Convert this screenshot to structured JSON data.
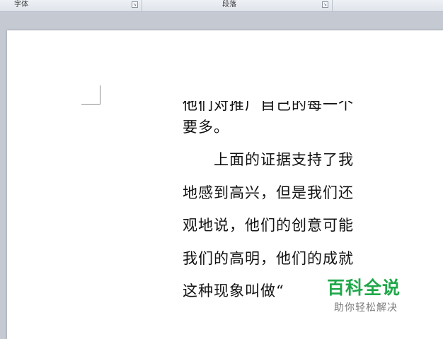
{
  "ribbon": {
    "groups": [
      {
        "label": "字体",
        "launcher_icon": "dialog-launcher-icon"
      },
      {
        "label": "段落",
        "launcher_icon": "dialog-launcher-icon"
      }
    ]
  },
  "document": {
    "lines": [
      "他们对推广自己的每一个",
      "要多。",
      "　　上面的证据支持了我",
      "地感到高兴，但是我们还",
      "观地说，他们的创意可能",
      "我们的高明，他们的成就",
      "这种现象叫做“"
    ]
  },
  "watermark": {
    "title": "百科全说",
    "subtitle": "助你轻松解决"
  }
}
